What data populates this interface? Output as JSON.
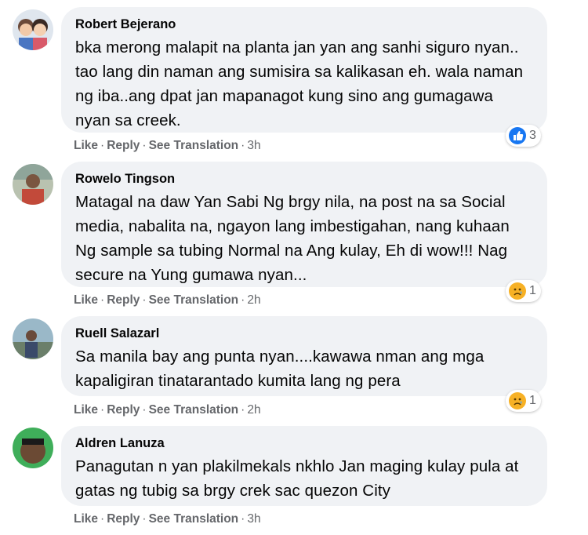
{
  "action_labels": {
    "like": "Like",
    "reply": "Reply",
    "translate": "See Translation",
    "separator": "·"
  },
  "comments": [
    {
      "author": "Robert Bejerano",
      "text": "bka merong malapit na planta jan yan ang sanhi siguro nyan.. tao lang din naman ang sumisira sa kalikasan eh. wala naman ng iba..ang dpat jan mapanagot kung sino ang gumagawa nyan sa creek.",
      "time": "3h",
      "reaction_icon": "like-icon",
      "reaction_count": "3"
    },
    {
      "author": "Rowelo Tingson",
      "text": "Matagal na daw Yan Sabi Ng brgy nila, na post na sa Social media, nabalita na, ngayon lang imbestigahan, nang kuhaan Ng sample sa tubing Normal na Ang kulay, Eh di wow!!! Nag secure na Yung gumawa nyan...",
      "time": "2h",
      "reaction_icon": "sad-icon",
      "reaction_count": "1"
    },
    {
      "author": "Ruell Salazarl",
      "text": "Sa manila bay ang punta nyan....kawawa nman ang mga kapaligiran tinatarantado kumita lang ng pera",
      "time": "2h",
      "reaction_icon": "sad-icon",
      "reaction_count": "1"
    },
    {
      "author": "Aldren Lanuza",
      "text": "Panagutan n yan plakilmekals nkhlo Jan maging kulay pula at gatas ng tubig sa brgy crek sac quezon City",
      "time": "3h"
    }
  ]
}
